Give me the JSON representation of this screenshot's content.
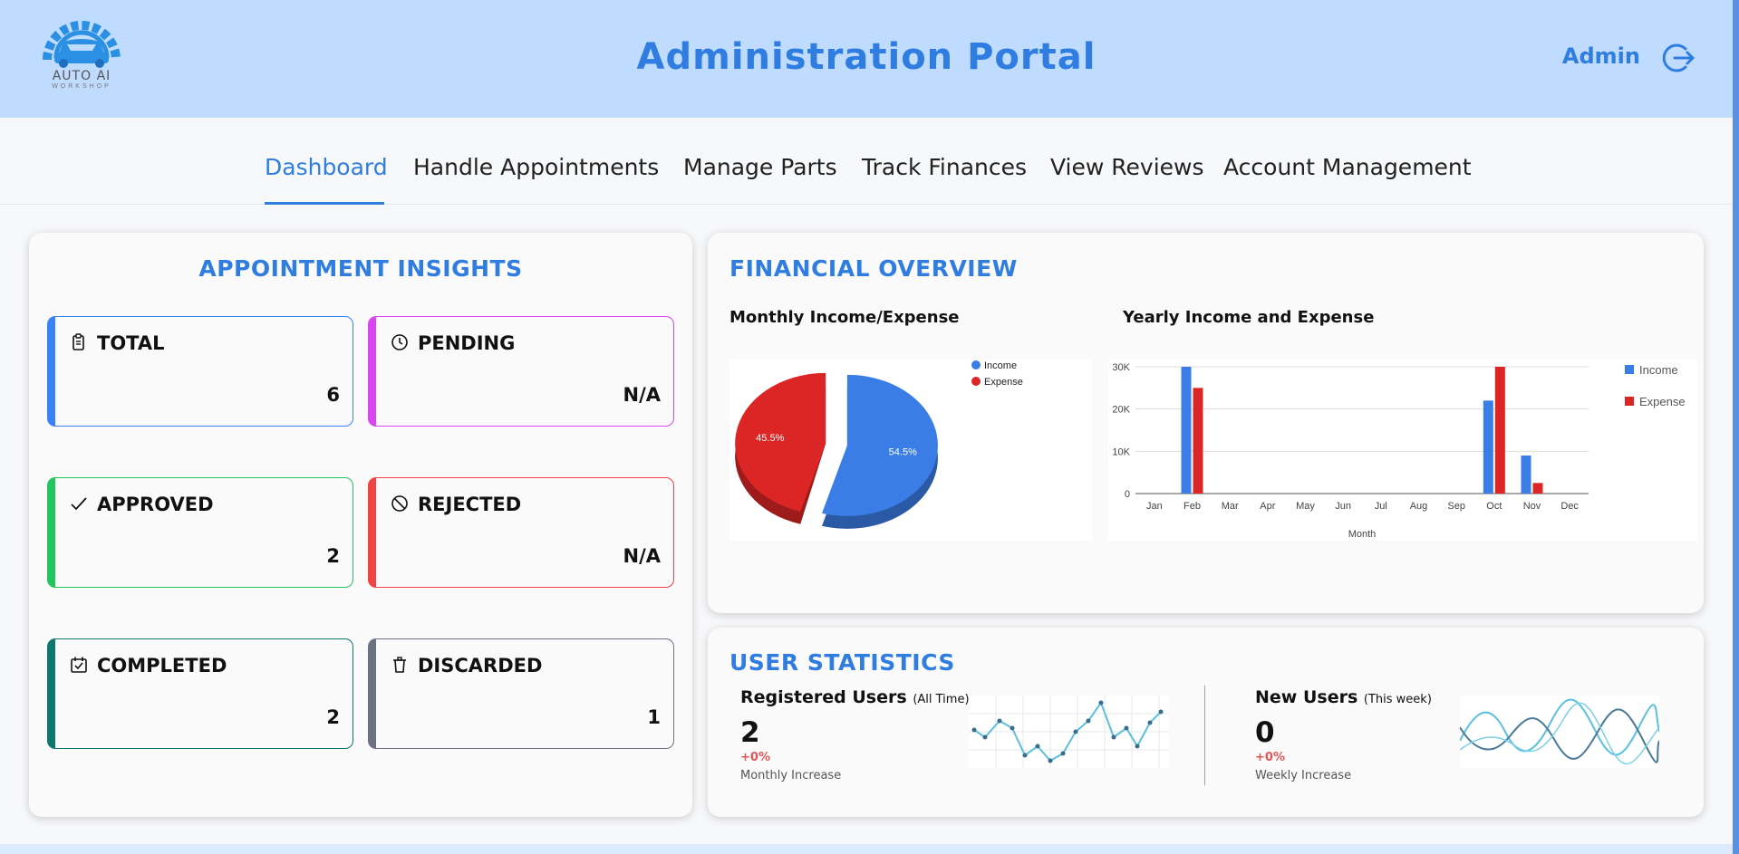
{
  "header": {
    "logo_text": "AUTO AI",
    "logo_sub": "WORKSHOP",
    "title": "Administration Portal",
    "user": "Admin",
    "logout_icon": "logout-icon"
  },
  "nav": {
    "tabs": [
      {
        "label": "Dashboard",
        "active": true
      },
      {
        "label": "Handle Appointments",
        "active": false
      },
      {
        "label": "Manage Parts",
        "active": false
      },
      {
        "label": "Track Finances",
        "active": false
      },
      {
        "label": "View Reviews",
        "active": false
      },
      {
        "label": "Account Management",
        "active": false
      }
    ]
  },
  "appointments": {
    "title": "APPOINTMENT INSIGHTS",
    "cards": [
      {
        "label": "TOTAL",
        "value": "6",
        "icon": "clipboard-icon",
        "color": "#3b82f6"
      },
      {
        "label": "PENDING",
        "value": "N/A",
        "icon": "clock-icon",
        "color": "#d946ef"
      },
      {
        "label": "APPROVED",
        "value": "2",
        "icon": "check-icon",
        "color": "#22c55e"
      },
      {
        "label": "REJECTED",
        "value": "N/A",
        "icon": "ban-icon",
        "color": "#ef4444"
      },
      {
        "label": "COMPLETED",
        "value": "2",
        "icon": "calendar-check-icon",
        "color": "#0f766e"
      },
      {
        "label": "DISCARDED",
        "value": "1",
        "icon": "trash-icon",
        "color": "#6b7280"
      }
    ]
  },
  "financial": {
    "title": "FINANCIAL OVERVIEW",
    "monthly_heading": "Monthly Income/Expense",
    "yearly_heading": "Yearly Income and Expense"
  },
  "chart_data": [
    {
      "type": "pie",
      "title": "",
      "labels": [
        "Income",
        "Expense"
      ],
      "values": [
        54.5,
        45.5
      ],
      "value_labels": [
        "54.5%",
        "45.5%"
      ],
      "colors": [
        "#3b7de6",
        "#dc2626"
      ],
      "legend": "top-right"
    },
    {
      "type": "bar",
      "title": "",
      "categories": [
        "Jan",
        "Feb",
        "Mar",
        "Apr",
        "May",
        "Jun",
        "Jul",
        "Aug",
        "Sep",
        "Oct",
        "Nov",
        "Dec"
      ],
      "series": [
        {
          "name": "Income",
          "values": [
            0,
            30000,
            0,
            0,
            0,
            0,
            0,
            0,
            0,
            22000,
            9000,
            0
          ],
          "color": "#3b7de6"
        },
        {
          "name": "Expense",
          "values": [
            0,
            25000,
            0,
            0,
            0,
            0,
            0,
            0,
            0,
            30000,
            2500,
            0
          ],
          "color": "#dc2626"
        }
      ],
      "xlabel": "Month",
      "ylabel": "",
      "ylim": [
        0,
        30000
      ],
      "yticks": [
        {
          "value": 0,
          "label": "0"
        },
        {
          "value": 10000,
          "label": "10K"
        },
        {
          "value": 20000,
          "label": "20K"
        },
        {
          "value": 30000,
          "label": "30K"
        }
      ],
      "grid": true,
      "legend": "right"
    }
  ],
  "users": {
    "title": "USER STATISTICS",
    "registered": {
      "label": "Registered Users",
      "qualifier": "(All Time)",
      "value": "2",
      "change": "+0%",
      "caption": "Monthly Increase"
    },
    "new": {
      "label": "New Users",
      "qualifier": "(This week)",
      "value": "0",
      "change": "+0%",
      "caption": "Weekly Increase"
    }
  }
}
